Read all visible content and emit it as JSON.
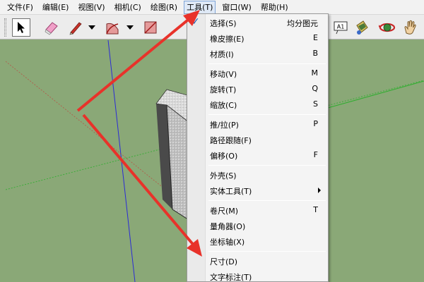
{
  "menubar": {
    "items": [
      {
        "label": "文件(F)"
      },
      {
        "label": "编辑(E)"
      },
      {
        "label": "视图(V)"
      },
      {
        "label": "相机(C)"
      },
      {
        "label": "绘图(R)"
      },
      {
        "label": "工具(T)",
        "active": true
      },
      {
        "label": "窗口(W)"
      },
      {
        "label": "帮助(H)"
      }
    ]
  },
  "toolbar": {
    "tools": [
      {
        "name": "select-tool-icon",
        "pressed": true
      },
      {
        "name": "eraser-tool-icon"
      },
      {
        "name": "pencil-tool-icon"
      },
      {
        "name": "arc-tool-icon"
      },
      {
        "name": "rectangle-tool-icon"
      },
      {
        "name": "text-tool-icon"
      },
      {
        "name": "paint-bucket-icon"
      },
      {
        "name": "orbit-tool-icon"
      },
      {
        "name": "pan-hand-icon"
      }
    ],
    "text_tool_label": "A1"
  },
  "tools_menu": {
    "items": [
      {
        "label": "选择(S)",
        "shortcut": "均分图元",
        "checked": true
      },
      {
        "label": "橡皮擦(E)",
        "shortcut": "E"
      },
      {
        "label": "材质(I)",
        "shortcut": "B"
      },
      {
        "separator": true
      },
      {
        "label": "移动(V)",
        "shortcut": "M"
      },
      {
        "label": "旋转(T)",
        "shortcut": "Q"
      },
      {
        "label": "缩放(C)",
        "shortcut": "S"
      },
      {
        "separator": true
      },
      {
        "label": "推/拉(P)",
        "shortcut": "P"
      },
      {
        "label": "路径跟随(F)",
        "shortcut": ""
      },
      {
        "label": "偏移(O)",
        "shortcut": "F"
      },
      {
        "separator": true
      },
      {
        "label": "外壳(S)",
        "shortcut": ""
      },
      {
        "label": "实体工具(T)",
        "shortcut": "",
        "submenu": true
      },
      {
        "separator": true
      },
      {
        "label": "卷尺(M)",
        "shortcut": "T"
      },
      {
        "label": "量角器(O)",
        "shortcut": ""
      },
      {
        "label": "坐标轴(X)",
        "shortcut": ""
      },
      {
        "separator": true
      },
      {
        "label": "尺寸(D)",
        "shortcut": ""
      },
      {
        "label": "文字标注(T)",
        "shortcut": ""
      }
    ]
  },
  "colors": {
    "viewport_ground": "#8aa877",
    "annotation_arrow": "#e8322a",
    "axis_blue": "#2b2bd6",
    "axis_green": "#2fae2f",
    "axis_red": "#c83232",
    "menu_check": "#1c5db3"
  }
}
